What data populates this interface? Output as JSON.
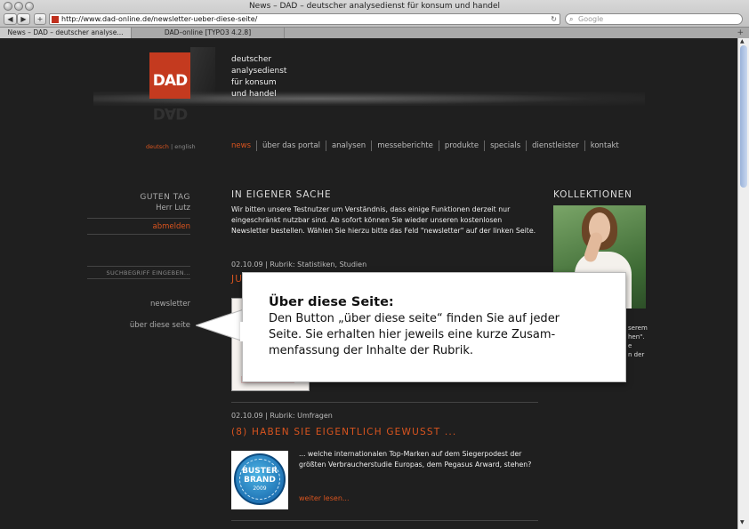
{
  "browser": {
    "window_title": "News – DAD – deutscher analysedienst für konsum und handel",
    "url": "http://www.dad-online.de/newsletter-ueber-diese-seite/",
    "search_placeholder": "Google",
    "tabs": [
      {
        "label": "News – DAD – deutscher analyse..."
      },
      {
        "label": "DAD–online [TYPO3 4.2.8]"
      }
    ]
  },
  "header": {
    "logo_text": "DAD",
    "brand_lines": [
      "deutscher",
      "analysedienst",
      "für konsum",
      "und handel"
    ],
    "lang_active": "deutsch",
    "lang_separator": "|",
    "lang_other": "english",
    "nav": [
      {
        "label": "news"
      },
      {
        "label": "über das portal"
      },
      {
        "label": "analysen"
      },
      {
        "label": "messeberichte"
      },
      {
        "label": "produkte"
      },
      {
        "label": "specials"
      },
      {
        "label": "dienstleister"
      },
      {
        "label": "kontakt"
      }
    ]
  },
  "sidebar": {
    "greeting": "GUTEN TAG",
    "username": "Herr Lutz",
    "logout": "abmelden",
    "search_placeholder": "SUCHBEGRIFF EINGEBEN...",
    "links": [
      {
        "label": "newsletter"
      },
      {
        "label": "über diese seite"
      }
    ]
  },
  "main": {
    "notice_heading": "IN EIGENER SACHE",
    "notice_body": "Wir bitten unsere Testnutzer um Verständnis, dass einige Funktionen derzeit nur eingeschränkt nutzbar sind. Ab sofort können Sie wieder unseren kostenlosen Newsletter bestellen. Wählen Sie hierzu bitte das Feld \"newsletter\" auf der linken Seite.",
    "articles": [
      {
        "meta": "02.10.09 | Rubrik: Statistiken, Studien",
        "headline": "JU"
      },
      {
        "meta": "02.10.09 | Rubrik: Umfragen",
        "headline": "(8) HABEN SIE EIGENTLICH GEWUSST ...",
        "teaser": "... welche internationalen Top-Marken auf dem Siegerpodest der größten Verbraucherstudie Europas, dem Pegasus Arward, stehen?",
        "read_more": "weiter lesen...",
        "badge": {
          "line1": "BUSTER",
          "line2": "BRAND",
          "line3": "2009"
        }
      }
    ]
  },
  "right": {
    "heading": "KOLLEKTIONEN",
    "snippet_lines": [
      "serem",
      "hen\".",
      "e",
      "n der"
    ]
  },
  "callout": {
    "title": "Über diese Seite:",
    "body": "Den Button „über diese seite“ finden Sie auf jeder Seite. Sie erhalten hier jeweils eine kurze Zusam-menfassung der Inhalte der Rubrik."
  },
  "colors": {
    "accent": "#d9541f",
    "logo": "#c43a1f",
    "background": "#1f1f1f"
  }
}
